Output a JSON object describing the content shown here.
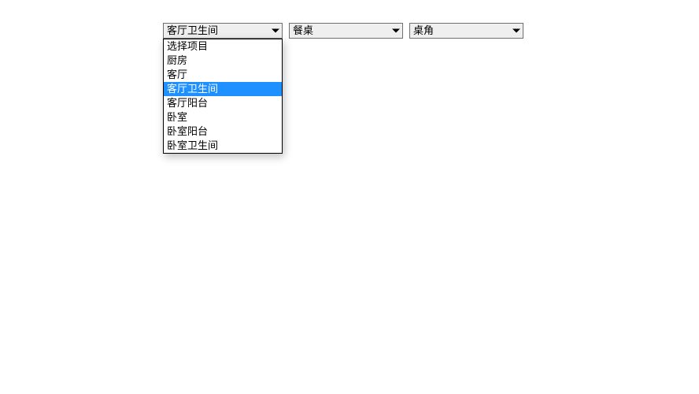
{
  "selects": {
    "s1": {
      "value": "客厅卫生间"
    },
    "s2": {
      "value": "餐桌"
    },
    "s3": {
      "value": "桌角"
    }
  },
  "dropdown": {
    "selectedIndex": 3,
    "items": [
      {
        "label": "选择项目"
      },
      {
        "label": "厨房"
      },
      {
        "label": "客厅"
      },
      {
        "label": "客厅卫生间"
      },
      {
        "label": "客厅阳台"
      },
      {
        "label": "卧室"
      },
      {
        "label": "卧室阳台"
      },
      {
        "label": "卧室卫生间"
      }
    ]
  }
}
